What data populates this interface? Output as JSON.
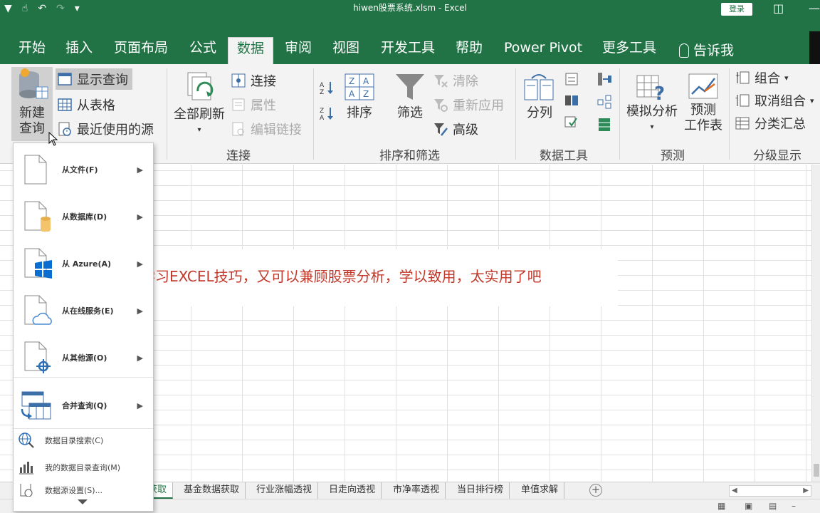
{
  "window": {
    "title": "hiwen股票系统.xlsm  -  Excel",
    "login_label": "登录"
  },
  "tabs": [
    {
      "label": "开始"
    },
    {
      "label": "插入"
    },
    {
      "label": "页面布局"
    },
    {
      "label": "公式"
    },
    {
      "label": "数据",
      "active": true
    },
    {
      "label": "审阅"
    },
    {
      "label": "视图"
    },
    {
      "label": "开发工具"
    },
    {
      "label": "帮助"
    },
    {
      "label": "Power Pivot"
    },
    {
      "label": "更多工具"
    },
    {
      "label": "告诉我"
    }
  ],
  "ribbon": {
    "get_transform": {
      "new_query_line1": "新建",
      "new_query_line2": "查询",
      "show_queries": "显示查询",
      "from_table": "从表格",
      "recent_sources": "最近使用的源"
    },
    "connections": {
      "refresh_all": "全部刷新",
      "connections": "连接",
      "properties": "属性",
      "edit_links": "编辑链接",
      "group_label": "连接"
    },
    "sort_filter": {
      "sort": "排序",
      "filter": "筛选",
      "clear": "清除",
      "reapply": "重新应用",
      "advanced": "高级",
      "group_label": "排序和筛选"
    },
    "data_tools": {
      "text_to_columns": "分列",
      "group_label": "数据工具"
    },
    "forecast": {
      "what_if": "模拟分析",
      "forecast_sheet_line1": "预测",
      "forecast_sheet_line2": "工作表",
      "group_label": "预测"
    },
    "outline": {
      "group": "组合",
      "ungroup": "取消组合",
      "subtotal": "分类汇总",
      "group_label": "分级显示"
    }
  },
  "dropdown": {
    "items": [
      {
        "label": "从文件(F)",
        "icon": "file-icon"
      },
      {
        "label": "从数据库(D)",
        "icon": "database-file-icon"
      },
      {
        "label": "从 Azure(A)",
        "icon": "azure-windows-icon"
      },
      {
        "label": "从在线服务(E)",
        "icon": "cloud-file-icon"
      },
      {
        "label": "从其他源(O)",
        "icon": "other-source-icon"
      },
      {
        "label": "合并查询(Q)",
        "icon": "combine-query-icon"
      }
    ],
    "small_items": [
      {
        "label": "数据目录搜索(C)",
        "icon": "globe-search-icon"
      },
      {
        "label": "我的数据目录查询(M)",
        "icon": "bar-chart-icon"
      },
      {
        "label": "数据源设置(S)...",
        "icon": "data-source-settings-icon"
      }
    ]
  },
  "sheet": {
    "overlay_text": "学习EXCEL技巧，又可以兼顾股票分析，学以致用，太实用了吧"
  },
  "sheet_tabs": [
    {
      "label": "获取",
      "active": true
    },
    {
      "label": "基金数据获取"
    },
    {
      "label": "行业涨幅透视"
    },
    {
      "label": "日走向透视"
    },
    {
      "label": "市净率透视"
    },
    {
      "label": "当日排行榜"
    },
    {
      "label": "单值求解"
    }
  ],
  "colors": {
    "excel_green": "#217346",
    "overlay_text_color": "#c0392b"
  }
}
